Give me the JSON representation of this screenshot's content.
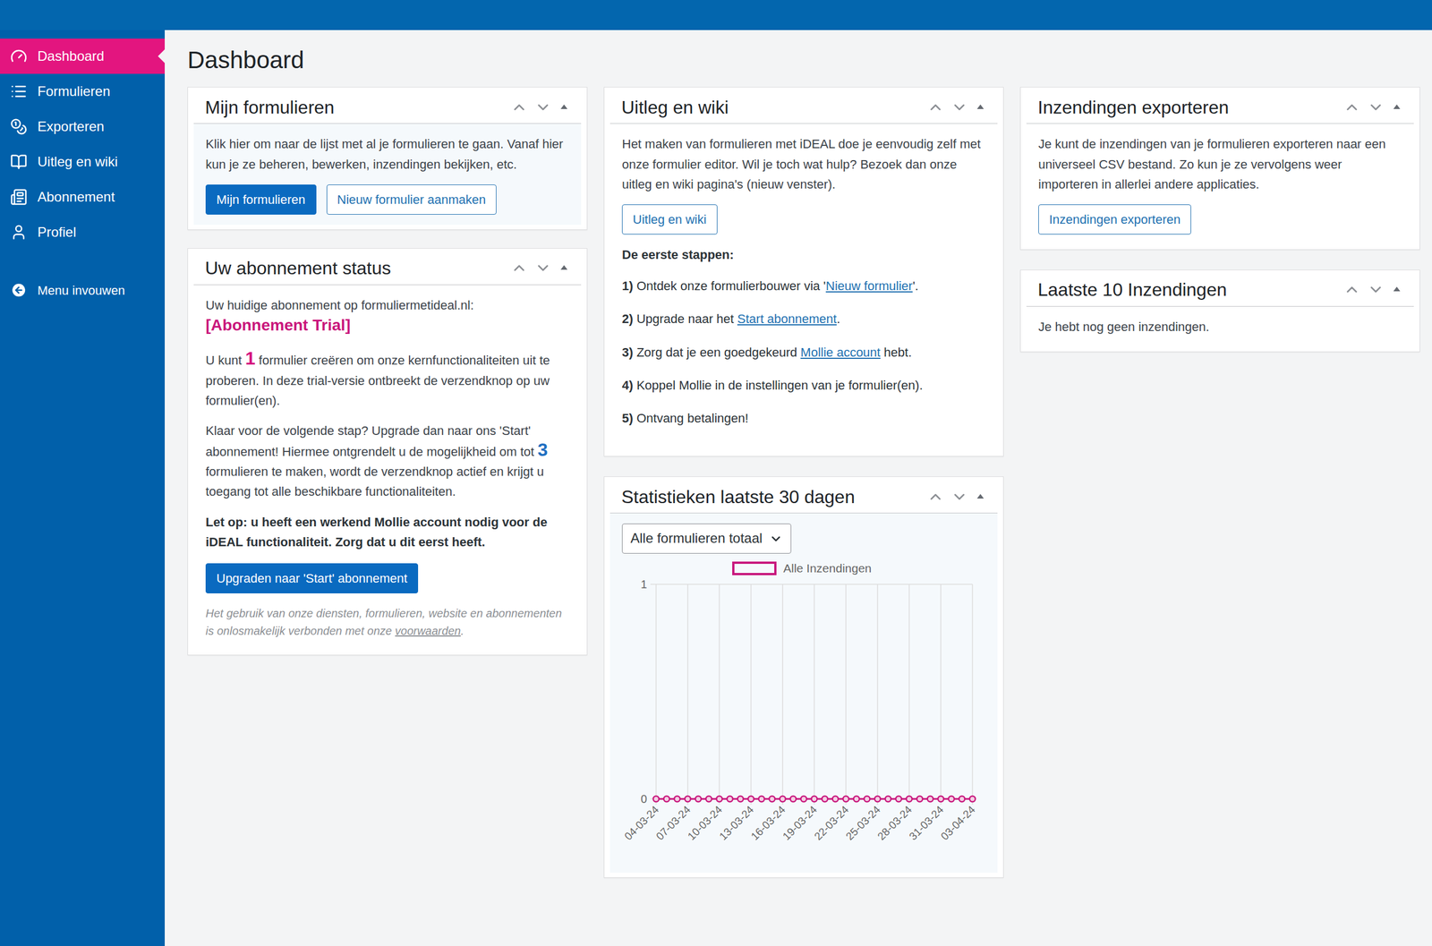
{
  "sidebar": {
    "items": [
      {
        "label": "Dashboard",
        "selected": true
      },
      {
        "label": "Formulieren",
        "selected": false
      },
      {
        "label": "Exporteren",
        "selected": false
      },
      {
        "label": "Uitleg en wiki",
        "selected": false
      },
      {
        "label": "Abonnement",
        "selected": false
      },
      {
        "label": "Profiel",
        "selected": false
      }
    ],
    "collapse": "Menu invouwen"
  },
  "page_title": "Dashboard",
  "my_forms": {
    "title": "Mijn formulieren",
    "text": "Klik hier om naar de lijst met al je formulieren te gaan. Vanaf hier kun je ze beheren, bewerken, inzendingen bekijken, etc.",
    "buttons": [
      {
        "label": "Mijn formulieren",
        "kind": "primary"
      },
      {
        "label": "Nieuw formulier aanmaken",
        "kind": "outline"
      }
    ]
  },
  "subscription": {
    "title": "Uw abonnement status",
    "intro": "Uw huidige abonnement op formuliermetideal.nl:",
    "plan": "[Abonnement Trial]",
    "paragraphs": [
      {
        "before": "U kunt ",
        "number": "1",
        "after": " formulier creëren om onze kernfunctionaliteiten uit te proberen. In deze trial-versie ontbreekt de verzendknop op uw formulier(en).",
        "color": "#d4147f"
      },
      {
        "before": "Klaar voor de volgende stap? Upgrade dan naar ons 'Start' abonnement! Hiermee ontgrendelt u de mogelijkheid om tot ",
        "number": "3",
        "after": " formulieren te maken, wordt de verzendknop actief en krijgt u toegang tot alle beschikbare functionaliteiten.",
        "color": "#1f6fc1"
      }
    ],
    "warning": "Let op: u heeft een werkend Mollie account nodig voor de iDEAL functionaliteit. Zorg dat u dit eerst heeft.",
    "button": "Upgraden naar 'Start' abonnement",
    "footnote": {
      "before": "Het gebruik van onze diensten, formulieren, website en abonnementen is onlosmakelijk verbonden met onze ",
      "link": "voorwaarden",
      "after": "."
    }
  },
  "wiki": {
    "title": "Uitleg en wiki",
    "text": "Het maken van formulieren met iDEAL doe je eenvoudig zelf met onze formulier editor. Wil je toch wat hulp? Bezoek dan onze uitleg en wiki pagina's (nieuw venster).",
    "button": "Uitleg en wiki",
    "steps_title": "De eerste stappen:",
    "steps": [
      {
        "number": "1)",
        "before": " Ontdek onze formulierbouwer via '",
        "link": "Nieuw formulier",
        "after": "'."
      },
      {
        "number": "2)",
        "before": " Upgrade naar het ",
        "link": "Start abonnement",
        "after": "."
      },
      {
        "number": "3)",
        "before": " Zorg dat je een goedgekeurd ",
        "link": "Mollie account",
        "after": " hebt."
      },
      {
        "number": "4)",
        "before": " Koppel Mollie in de instellingen van je formulier(en).",
        "after": ""
      },
      {
        "number": "5)",
        "before": " Ontvang betalingen!",
        "after": ""
      }
    ]
  },
  "stats": {
    "title": "Statistieken laatste 30 dagen",
    "select": "Alle formulieren totaal",
    "legend": "Alle Inzendingen",
    "y_ticks": [
      "1",
      "0"
    ],
    "x_labels": [
      "04-03-24",
      "07-03-24",
      "10-03-24",
      "13-03-24",
      "16-03-24",
      "19-03-24",
      "22-03-24",
      "25-03-24",
      "28-03-24",
      "31-03-24",
      "03-04-24"
    ],
    "values": [
      0,
      0,
      0,
      0,
      0,
      0,
      0,
      0,
      0,
      0,
      0,
      0,
      0,
      0,
      0,
      0,
      0,
      0,
      0,
      0,
      0,
      0,
      0,
      0,
      0,
      0,
      0,
      0,
      0,
      0,
      0
    ]
  },
  "export": {
    "title": "Inzendingen exporteren",
    "text": "Je kunt de inzendingen van je formulieren exporteren naar een universeel CSV bestand. Zo kun je ze vervolgens weer importeren in allerlei andere applicaties.",
    "button": "Inzendingen exporteren"
  },
  "latest": {
    "title": "Laatste 10 Inzendingen",
    "text": "Je hebt nog geen inzendingen."
  }
}
